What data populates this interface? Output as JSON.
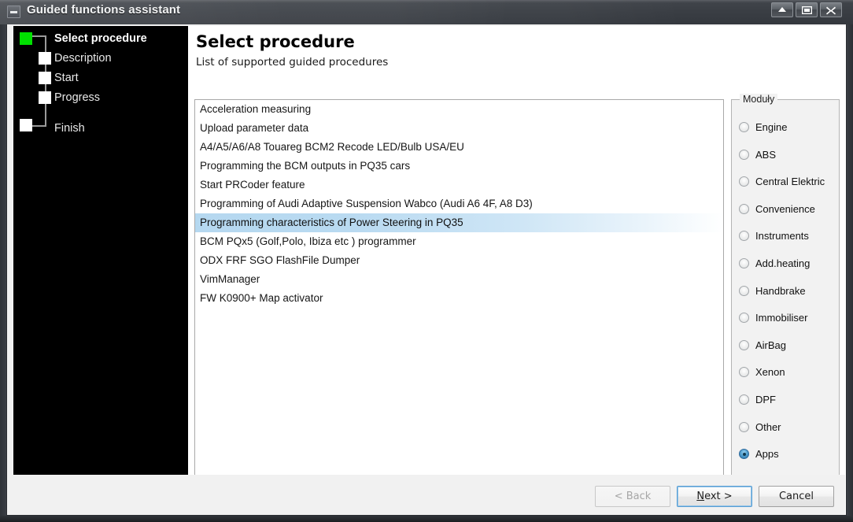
{
  "window": {
    "title": "Guided functions assistant",
    "icon": "window-menu-icon",
    "buttons": {
      "minimize": "minimize-chevron",
      "maximize": "maximize-box",
      "close": "X"
    }
  },
  "wizard_steps": [
    {
      "label": "Select procedure",
      "active": true
    },
    {
      "label": "Description",
      "active": false
    },
    {
      "label": "Start",
      "active": false
    },
    {
      "label": "Progress",
      "active": false
    },
    {
      "label": "Finish",
      "active": false
    }
  ],
  "header": {
    "title": "Select procedure",
    "subtitle": "List of supported guided procedures"
  },
  "procedure_list": [
    {
      "label": "Acceleration measuring",
      "selected": false
    },
    {
      "label": "Upload parameter data",
      "selected": false
    },
    {
      "label": "A4/A5/A6/A8 Touareg BCM2 Recode LED/Bulb USA/EU",
      "selected": false
    },
    {
      "label": "Programming the BCM outputs in PQ35 cars",
      "selected": false
    },
    {
      "label": "Start PRCoder feature",
      "selected": false
    },
    {
      "label": "Programming of Audi Adaptive Suspension Wabco (Audi A6 4F, A8 D3)",
      "selected": false
    },
    {
      "label": "Programming characteristics of Power Steering in PQ35",
      "selected": true
    },
    {
      "label": "BCM PQx5 (Golf,Polo, Ibiza etc ) programmer",
      "selected": false
    },
    {
      "label": "ODX FRF SGO FlashFile Dumper",
      "selected": false
    },
    {
      "label": "VimManager",
      "selected": false
    },
    {
      "label": "FW K0900+ Map activator",
      "selected": false
    }
  ],
  "modules": {
    "legend": "Moduły",
    "options": [
      {
        "label": "Engine",
        "checked": false
      },
      {
        "label": "ABS",
        "checked": false
      },
      {
        "label": "Central Elektric",
        "checked": false
      },
      {
        "label": "Convenience",
        "checked": false
      },
      {
        "label": "Instruments",
        "checked": false
      },
      {
        "label": "Add.heating",
        "checked": false
      },
      {
        "label": "Handbrake",
        "checked": false
      },
      {
        "label": "Immobiliser",
        "checked": false
      },
      {
        "label": "AirBag",
        "checked": false
      },
      {
        "label": "Xenon",
        "checked": false
      },
      {
        "label": "DPF",
        "checked": false
      },
      {
        "label": "Other",
        "checked": false
      },
      {
        "label": "Apps",
        "checked": true
      }
    ]
  },
  "footer": {
    "back": "< Back",
    "back_disabled": true,
    "next_prefix": "",
    "next_mnemonic": "N",
    "next_suffix": "ext >",
    "cancel": "Cancel"
  },
  "colors": {
    "selection_blue": "#b5d8f0",
    "active_step_green": "#00e000",
    "radio_checked_blue": "#2a6e9f",
    "focus_ring": "#5a9fd4",
    "sidebar_black": "#000000",
    "titlebar_gray": "#3f4349"
  }
}
